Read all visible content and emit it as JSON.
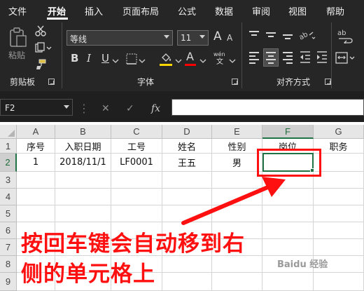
{
  "ribbon": {
    "tabs": [
      {
        "label": "文件",
        "active": false
      },
      {
        "label": "开始",
        "active": true
      },
      {
        "label": "插入",
        "active": false
      },
      {
        "label": "页面布局",
        "active": false
      },
      {
        "label": "公式",
        "active": false
      },
      {
        "label": "数据",
        "active": false
      },
      {
        "label": "审阅",
        "active": false
      },
      {
        "label": "视图",
        "active": false
      },
      {
        "label": "帮助",
        "active": false
      }
    ],
    "clipboard": {
      "paste_label": "粘贴",
      "group_label": "剪贴板"
    },
    "font": {
      "font_name": "等线",
      "font_size": "11",
      "bold": "B",
      "italic": "I",
      "underline": "U",
      "wen": "wén",
      "wen_char": "文",
      "grow": "A",
      "shrink": "A",
      "color_a": "A",
      "group_label": "字体",
      "accent_fill": "#ffd700",
      "accent_font": "#ff0000"
    },
    "alignment": {
      "group_label": "对齐方式"
    },
    "more": {
      "wrap_label": "ab",
      "wrap_sub": "c"
    }
  },
  "formula_bar": {
    "name_box": "F2",
    "cancel": "✕",
    "enter": "✓",
    "fx": "fx",
    "value": ""
  },
  "sheet": {
    "columns": [
      "A",
      "B",
      "C",
      "D",
      "E",
      "F",
      "G"
    ],
    "selected_column": "F",
    "rows": [
      "1",
      "2",
      "3",
      "4",
      "5",
      "6",
      "7",
      "8",
      "9"
    ],
    "selected_row": "2",
    "header_row": [
      "序号",
      "入职日期",
      "工号",
      "姓名",
      "性别",
      "岗位",
      "职务"
    ],
    "data_row": [
      "1",
      "2018/11/1",
      "LF0001",
      "王五",
      "男",
      "",
      ""
    ],
    "active_cell": "F2",
    "accent": "#217346"
  },
  "annotation": {
    "line1": "按回车键会自动移到右",
    "line2": "侧的单元格上",
    "color": "#ff1010"
  }
}
